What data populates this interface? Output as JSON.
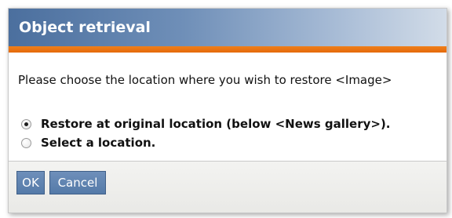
{
  "dialog": {
    "title": "Object retrieval",
    "prompt": "Please choose the location where you wish to restore <Image>",
    "options": [
      {
        "label": "Restore at original location (below <News gallery>).",
        "checked": true
      },
      {
        "label": "Select a location.",
        "checked": false
      }
    ],
    "buttons": {
      "ok": "OK",
      "cancel": "Cancel"
    }
  },
  "colors": {
    "titlebar_start": "#4b6f9e",
    "titlebar_end": "#d2dce8",
    "accent": "#e56a0c",
    "button": "#5f84b2"
  }
}
